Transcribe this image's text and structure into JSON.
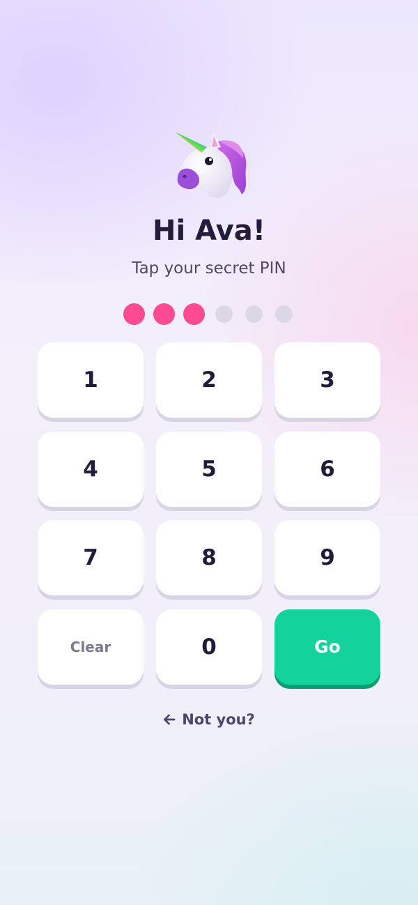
{
  "avatar": {
    "icon": "unicorn-icon"
  },
  "greeting": "Hi Ava!",
  "subtitle": "Tap your secret PIN",
  "pin": {
    "length": 6,
    "entered": 3
  },
  "colors": {
    "dot_filled": "#fe4a92",
    "dot_empty": "#dcd7e6",
    "go_button": "#13d29b",
    "text_dark": "#241c3b"
  },
  "keypad": {
    "k1": "1",
    "k2": "2",
    "k3": "3",
    "k4": "4",
    "k5": "5",
    "k6": "6",
    "k7": "7",
    "k8": "8",
    "k9": "9",
    "clear": "Clear",
    "k0": "0",
    "go": "Go"
  },
  "not_you": {
    "label": "Not you?",
    "icon": "arrow-left-icon"
  }
}
